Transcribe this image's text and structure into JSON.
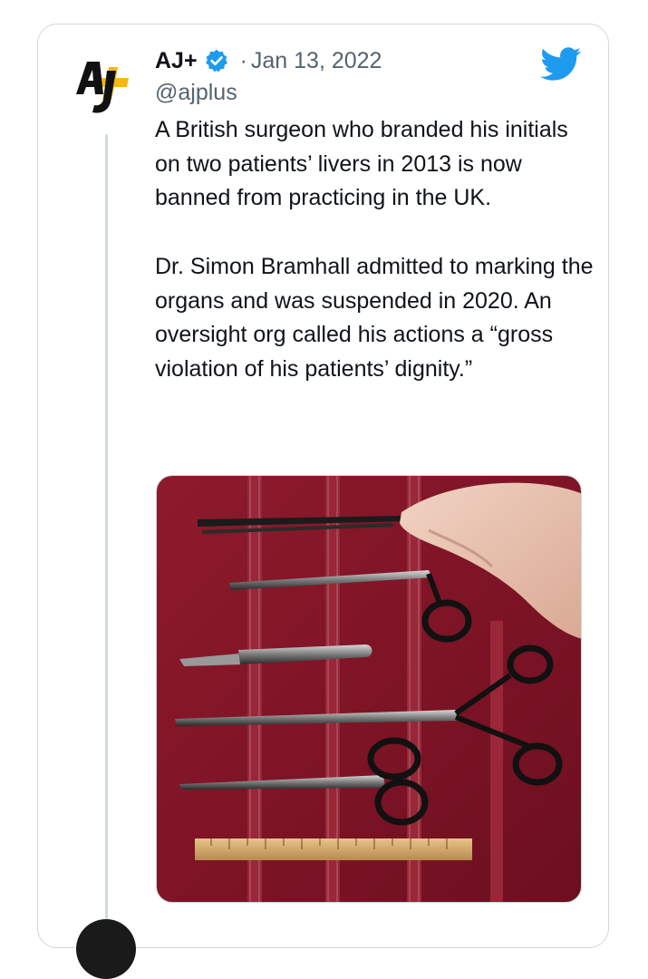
{
  "tweet": {
    "display_name": "AJ+",
    "separator": "·",
    "date": "Jan 13, 2022",
    "handle": "@ajplus",
    "text": "A British surgeon who branded his initials on two patients’ livers in 2013 is now banned from practicing in the UK.\n\nDr. Simon Bramhall admitted to marking the organs and was suspended in 2020. An oversight org called his actions a “gross violation of his patients’ dignity.”",
    "avatar_logo": "AJ+",
    "media_description_icon": "surgical-instruments-photo"
  },
  "colors": {
    "text": "#0f1419",
    "secondary": "#536471",
    "twitter_blue": "#1d9bf0",
    "border": "#cfd9de",
    "logo_yellow": "#f8b80c"
  },
  "icons": {
    "verified": "verified-badge-icon",
    "brand": "twitter-bird-icon"
  }
}
